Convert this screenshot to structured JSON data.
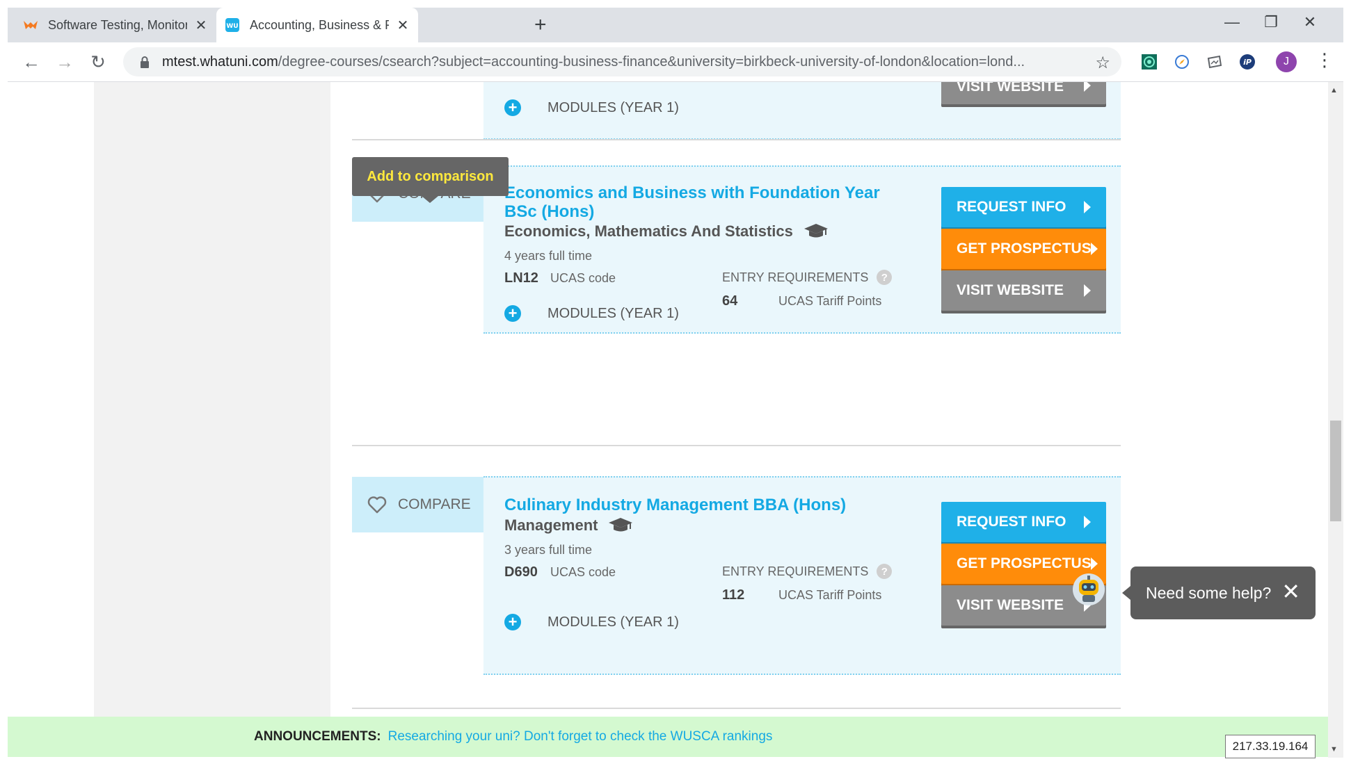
{
  "browser": {
    "tabs": [
      {
        "title": "Software Testing, Monitoring, De",
        "close": "✕"
      },
      {
        "title": "Accounting, Business & Finance D",
        "close": "✕"
      }
    ],
    "new_tab": "+",
    "window_controls": {
      "minimize": "—",
      "restore": "❐",
      "close": "✕"
    },
    "nav": {
      "back": "←",
      "forward": "→",
      "reload": "↻"
    },
    "url": {
      "host": "mtest.whatuni.com",
      "path": "/degree-courses/csearch?subject=accounting-business-finance&university=birkbeck-university-of-london&location=lond..."
    },
    "star": "☆",
    "profile_initial": "J",
    "menu": "⋮"
  },
  "top_card": {
    "modules_label": "MODULES (YEAR 1)",
    "visit_website": "VISIT WEBSITE"
  },
  "tooltip": {
    "text": "Add to comparison"
  },
  "courses": [
    {
      "compare_label": "COMPARE",
      "title": "Economics and Business with Foundation Year BSc (Hons)",
      "subject": "Economics, Mathematics And Statistics",
      "duration": "4 years full time",
      "ucas_code": "LN12",
      "ucas_code_label": "UCAS code",
      "entry_label": "ENTRY REQUIREMENTS",
      "tariff_points": "64",
      "tariff_label": "UCAS Tariff Points",
      "modules_label": "MODULES (YEAR 1)",
      "buttons": {
        "request": "REQUEST INFO",
        "prospectus": "GET PROSPECTUS",
        "visit": "VISIT WEBSITE"
      }
    },
    {
      "compare_label": "COMPARE",
      "title": "Culinary Industry Management BBA (Hons)",
      "subject": "Management",
      "duration": "3 years full time",
      "ucas_code": "D690",
      "ucas_code_label": "UCAS code",
      "entry_label": "ENTRY REQUIREMENTS",
      "tariff_points": "112",
      "tariff_label": "UCAS Tariff Points",
      "modules_label": "MODULES (YEAR 1)",
      "buttons": {
        "request": "REQUEST INFO",
        "prospectus": "GET PROSPECTUS",
        "visit": "VISIT WEBSITE"
      }
    }
  ],
  "help_widget": {
    "text": "Need some help?",
    "close": "✕"
  },
  "announcement": {
    "label": "ANNOUNCEMENTS:",
    "link": "Researching your uni? Don't forget to check the WUSCA rankings"
  },
  "ip_address": "217.33.19.164",
  "colors": {
    "brand_blue": "#14a9e3",
    "request_button": "#1fb0e8",
    "prospectus_button": "#ff8c0a",
    "visit_button": "#8c8c8c",
    "card_background": "#eaf7fc",
    "announcement_bar": "#d4f9d0"
  }
}
